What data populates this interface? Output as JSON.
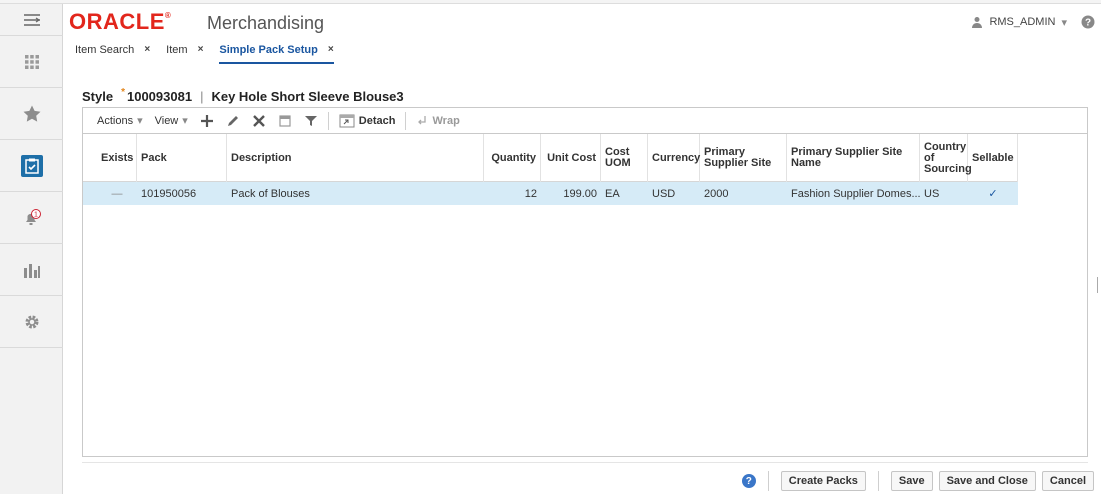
{
  "app": {
    "logo": "ORACLE",
    "logo_mark": "®",
    "name": "Merchandising"
  },
  "user": {
    "name": "RMS_ADMIN",
    "caret": "▾"
  },
  "rail": [
    "menu-icon",
    "apps-grid-icon",
    "favorites-star-icon",
    "tasks-clipboard-icon",
    "notifications-bell-icon",
    "reports-chart-icon",
    "settings-gear-icon"
  ],
  "notification_count": "1",
  "tabs": [
    {
      "label": "Item Search",
      "close": "×"
    },
    {
      "label": "Item",
      "close": "×"
    },
    {
      "label": "Simple Pack Setup",
      "close": "×"
    }
  ],
  "title": {
    "prefix": "Style",
    "required_mark": "*",
    "item_no": "100093081",
    "divider": "|",
    "item_name": "Key Hole Short Sleeve Blouse3"
  },
  "toolbar": {
    "actions": "Actions",
    "view": "View",
    "detach": "Detach",
    "wrap": "Wrap"
  },
  "columns": {
    "exists": "Exists",
    "pack": "Pack",
    "description": "Description",
    "quantity": "Quantity",
    "unit_cost": "Unit Cost",
    "cost_uom": "Cost UOM",
    "currency": "Currency",
    "supplier_site": "Primary Supplier Site",
    "supplier_site_name": "Primary Supplier Site Name",
    "country": "Country of Sourcing",
    "sellable": "Sellable"
  },
  "row": {
    "exists": "—",
    "pack": "101950056",
    "description": "Pack of Blouses",
    "quantity": "12",
    "unit_cost": "199.00",
    "cost_uom": "EA",
    "currency": "USD",
    "supplier_site": "2000",
    "supplier_site_name": "Fashion Supplier Domes...",
    "country": "US",
    "sellable": "✓"
  },
  "footer": {
    "help": "?",
    "create_packs": "Create Packs",
    "save": "Save",
    "save_close": "Save and Close",
    "cancel": "Cancel"
  },
  "colors": {
    "oracle_red": "#e2261c",
    "selected_row": "#d6ebf7",
    "active_tab": "#1a56a0",
    "rail_active": "#1e6fa8"
  }
}
